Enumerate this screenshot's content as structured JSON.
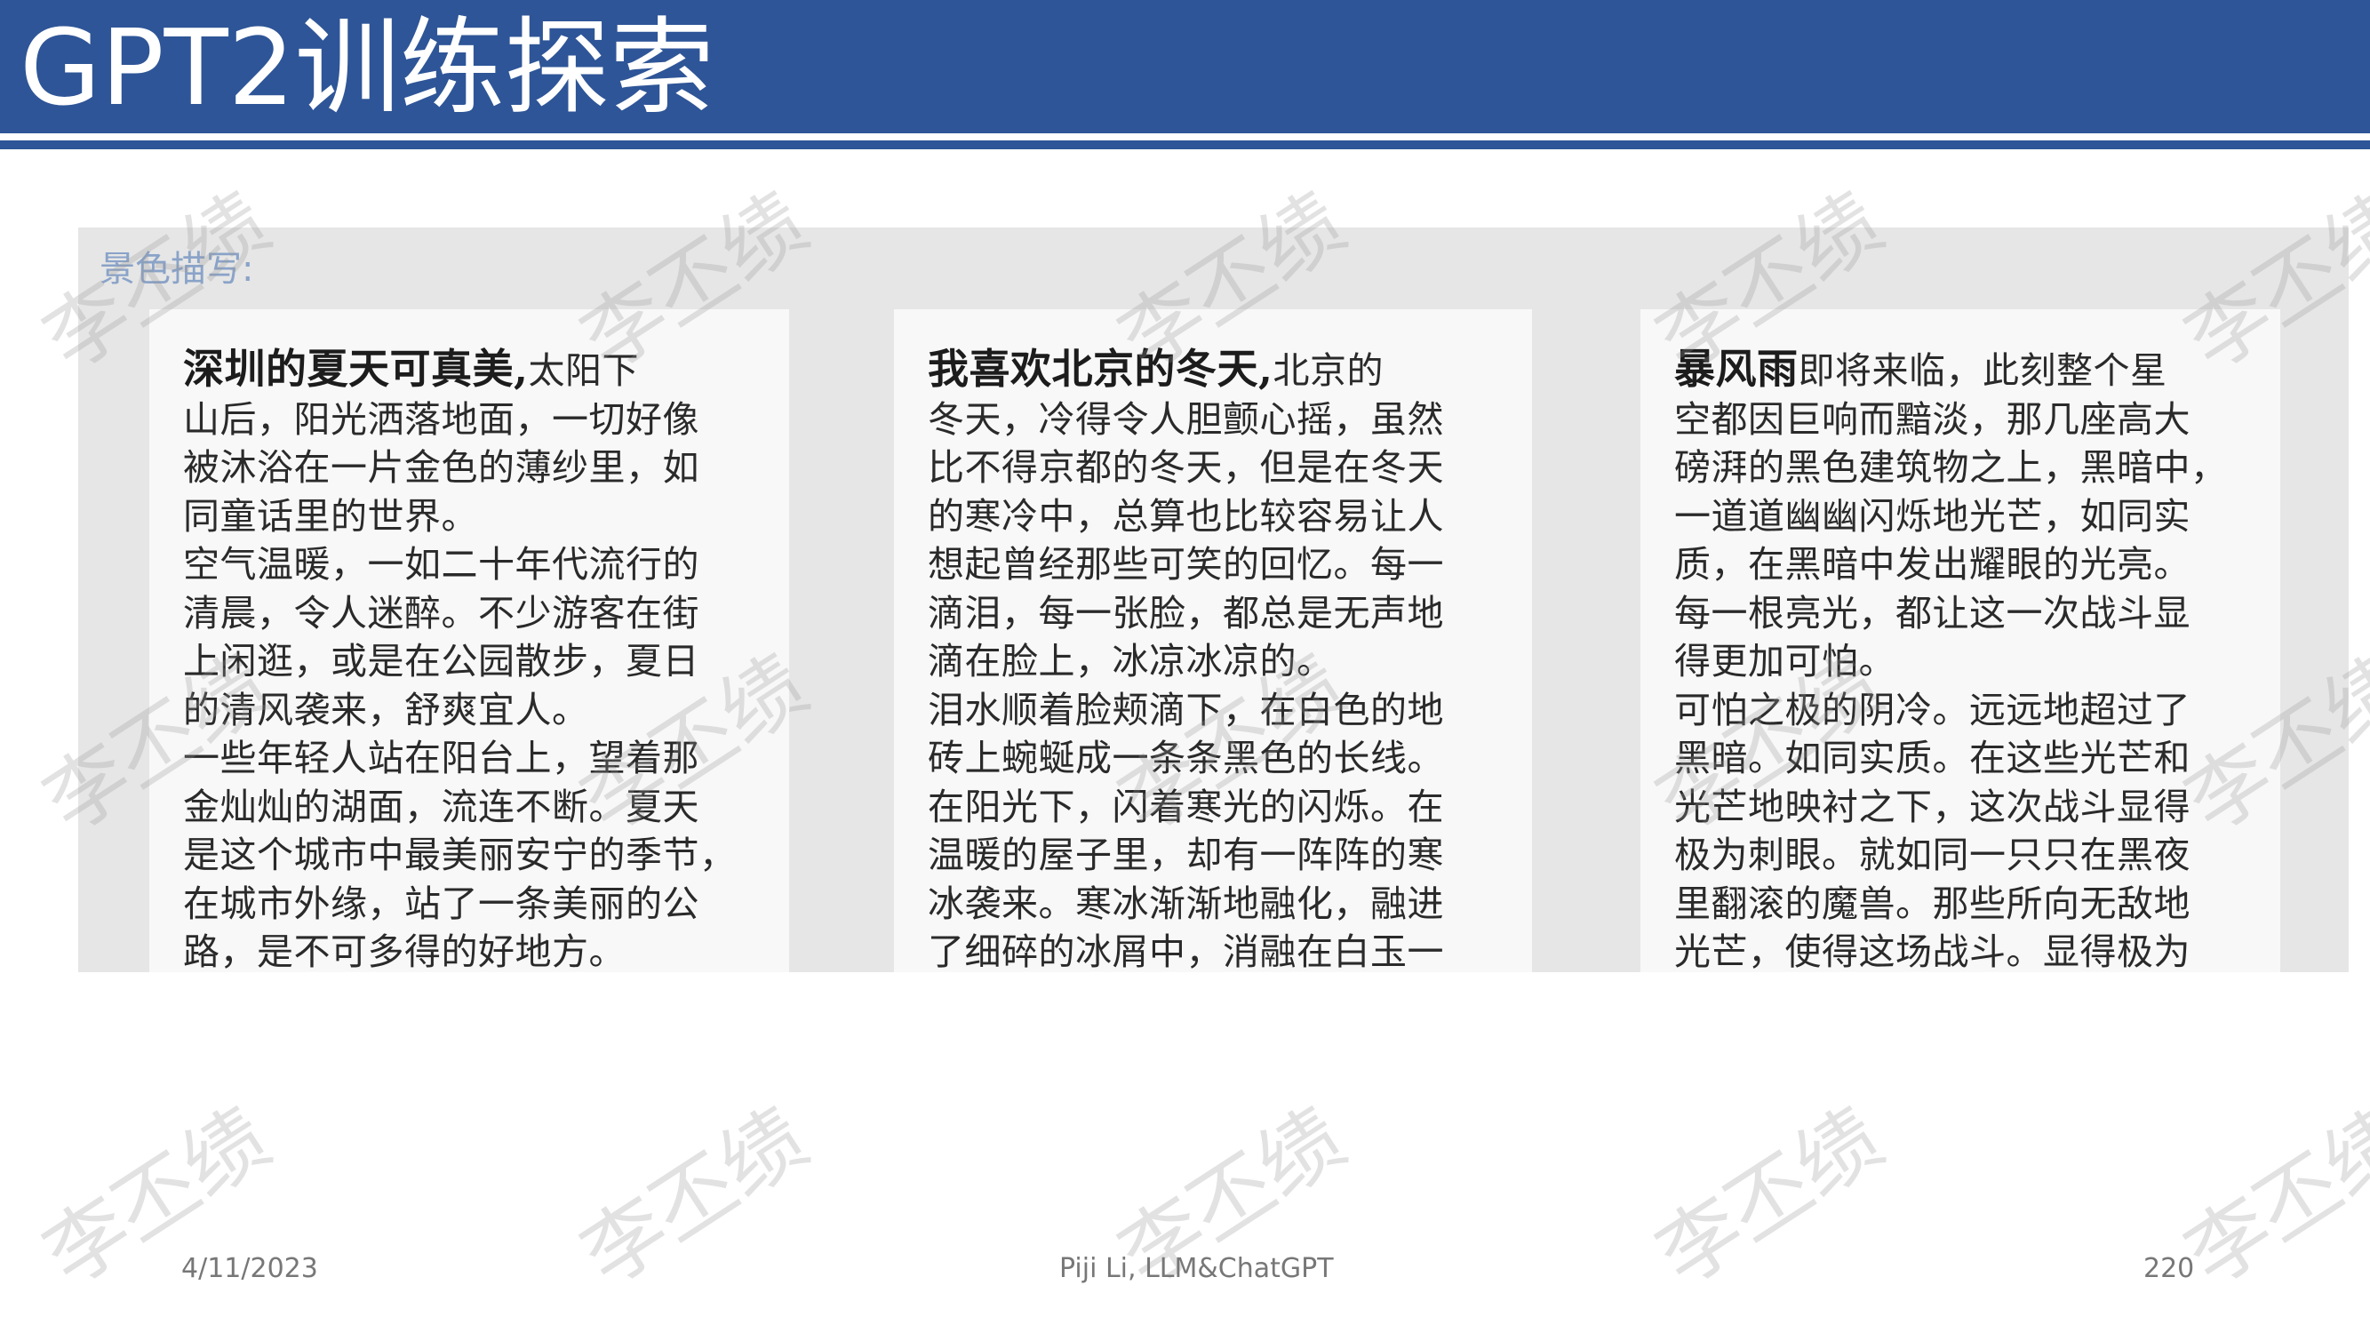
{
  "slide": {
    "title": "GPT2训练探索",
    "footer_date": "4/11/2023",
    "footer_author": "Piji Li, LLM&ChatGPT",
    "footer_page": "220",
    "watermark_text": "李丕绩"
  },
  "figure": {
    "label": "景色描写:",
    "cards": [
      {
        "heading": "深圳的夏天可真美,",
        "first_line_rest": "太阳下",
        "lines": [
          "山后，阳光洒落地面，一切好像",
          "被沐浴在一片金色的薄纱里，如",
          "同童话里的世界。",
          "空气温暖，一如二十年代流行的",
          "清晨，令人迷醉。不少游客在街",
          "上闲逛，或是在公园散步，夏日",
          "的清风袭来，舒爽宜人。",
          "一些年轻人站在阳台上，望着那",
          "金灿灿的湖面，流连不断。夏天",
          "是这个城市中最美丽安宁的季节，",
          "在城市外缘，站了一条美丽的公",
          "路，是不可多得的好地方。"
        ]
      },
      {
        "heading": "我喜欢北京的冬天,",
        "first_line_rest": "北京的",
        "lines": [
          "冬天，冷得令人胆颤心摇，虽然",
          "比不得京都的冬天，但是在冬天",
          "的寒冷中，总算也比较容易让人",
          "想起曾经那些可笑的回忆。每一",
          "滴泪，每一张脸，都总是无声地",
          "滴在脸上，冰凉冰凉的。",
          "泪水顺着脸颊滴下，在白色的地",
          "砖上蜿蜒成一条条黑色的长线。",
          "在阳光下，闪着寒光的闪烁。在",
          "温暖的屋子里，却有一阵阵的寒",
          "冰袭来。寒冰渐渐地融化，融进",
          "了细碎的冰屑中，消融在白玉一"
        ]
      },
      {
        "heading": "暴风雨",
        "first_line_rest": "即将来临，此刻整个星",
        "lines": [
          "空都因巨响而黯淡，那几座高大",
          "磅湃的黑色建筑物之上，黑暗中，",
          "一道道幽幽闪烁地光芒，如同实",
          "质，在黑暗中发出耀眼的光亮。",
          "每一根亮光，都让这一次战斗显",
          "得更加可怕。",
          "可怕之极的阴冷。远远地超过了",
          "黑暗。如同实质。在这些光芒和",
          "光芒地映衬之下，这次战斗显得",
          "极为刺眼。就如同一只只在黑夜",
          "里翻滚的魔兽。那些所向无敌地",
          "光芒，使得这场战斗。显得极为"
        ]
      }
    ]
  }
}
